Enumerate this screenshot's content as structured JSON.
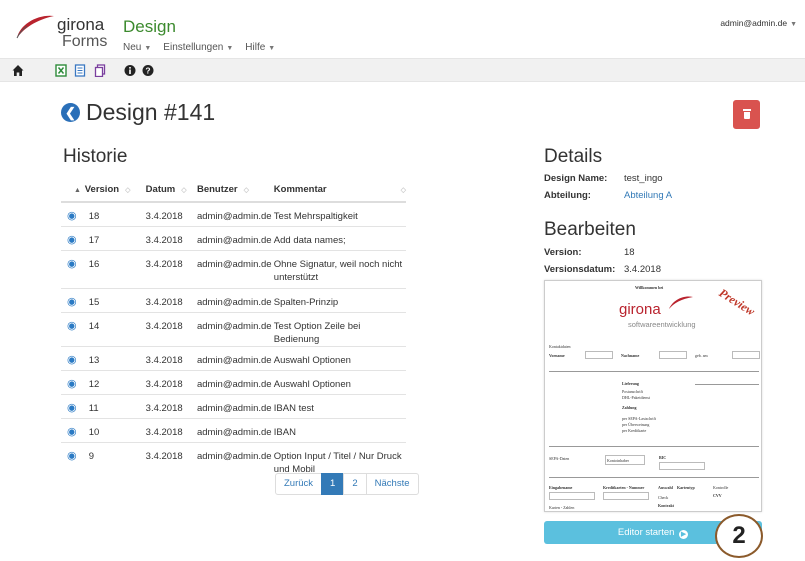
{
  "header": {
    "logo_word": "girona",
    "logo_sub": "Forms",
    "app_title": "Design",
    "menu": [
      {
        "label": "Neu"
      },
      {
        "label": "Einstellungen"
      },
      {
        "label": "Hilfe"
      }
    ],
    "user": "admin@admin.de"
  },
  "toolbar": {
    "icons": [
      "home-icon",
      "excel-icon",
      "form-icon",
      "copy-icon",
      "info-icon",
      "help-icon"
    ]
  },
  "page": {
    "title": "Design #141",
    "historie_title": "Historie"
  },
  "table": {
    "headers": {
      "version": "Version",
      "datum": "Datum",
      "benutzer": "Benutzer",
      "kommentar": "Kommentar"
    },
    "rows": [
      {
        "version": "18",
        "datum": "3.4.2018",
        "benutzer": "admin@admin.de",
        "kommentar": "Test Mehrspaltigkeit"
      },
      {
        "version": "17",
        "datum": "3.4.2018",
        "benutzer": "admin@admin.de",
        "kommentar": "Add data names;"
      },
      {
        "version": "16",
        "datum": "3.4.2018",
        "benutzer": "admin@admin.de",
        "kommentar": "Ohne Signatur, weil noch nicht unterstützt"
      },
      {
        "version": "15",
        "datum": "3.4.2018",
        "benutzer": "admin@admin.de",
        "kommentar": "Spalten-Prinzip"
      },
      {
        "version": "14",
        "datum": "3.4.2018",
        "benutzer": "admin@admin.de",
        "kommentar": "Test Option Zeile bei Bedienung"
      },
      {
        "version": "13",
        "datum": "3.4.2018",
        "benutzer": "admin@admin.de",
        "kommentar": "Auswahl Optionen"
      },
      {
        "version": "12",
        "datum": "3.4.2018",
        "benutzer": "admin@admin.de",
        "kommentar": "Auswahl Optionen"
      },
      {
        "version": "11",
        "datum": "3.4.2018",
        "benutzer": "admin@admin.de",
        "kommentar": "IBAN test"
      },
      {
        "version": "10",
        "datum": "3.4.2018",
        "benutzer": "admin@admin.de",
        "kommentar": "IBAN"
      },
      {
        "version": "9",
        "datum": "3.4.2018",
        "benutzer": "admin@admin.de",
        "kommentar": "Option Input / Titel / Nur Druck und Mobil"
      }
    ]
  },
  "pager": {
    "prev": "Zurück",
    "pages": [
      "1",
      "2"
    ],
    "active": "1",
    "next": "Nächste"
  },
  "details": {
    "title": "Details",
    "design_name_label": "Design Name:",
    "design_name": "test_ingo",
    "abteilung_label": "Abteilung:",
    "abteilung": "Abteilung A"
  },
  "bearbeiten": {
    "title": "Bearbeiten",
    "version_label": "Version:",
    "version": "18",
    "datum_label": "Versionsdatum:",
    "datum": "3.4.2018"
  },
  "preview": {
    "welcome": "Willkommen bei",
    "logo": "girona",
    "logo_sub": "softwareentwicklung",
    "stamp": "Preview",
    "kontakt": "Kontaktdaten",
    "vorname": "Vorname",
    "nachname": "Nachname",
    "gebam": "geb. am",
    "lieferung": "Lieferung",
    "opt1": "Postanschrift",
    "opt2": "DHL-Paketdienst",
    "zahlung": "Zahlung",
    "z1": "per SEPA-Lastschrift",
    "z2": "per Überweisung",
    "z3": "per Kreditkarte",
    "sepa": "SEPA-Daten",
    "kontoinhaber": "Kontoinhaber",
    "bic": "BIC",
    "eingabename": "Eingabename",
    "kreditkarten": "Kreditkarten - Nummer",
    "auswahl": "Auswahl",
    "kartentyp": "Kartentyp",
    "check": "Check",
    "kontrolle": "Kontrolle",
    "cvv": "CVV",
    "kontrakt": "Kontrakt",
    "karten": "Karten - Zahlen"
  },
  "editor_button": "Editor starten",
  "badge": "2",
  "colors": {
    "primary": "#337ab7",
    "danger": "#d9534f",
    "info": "#5bc0de",
    "brand_green": "#3c8a2e"
  }
}
